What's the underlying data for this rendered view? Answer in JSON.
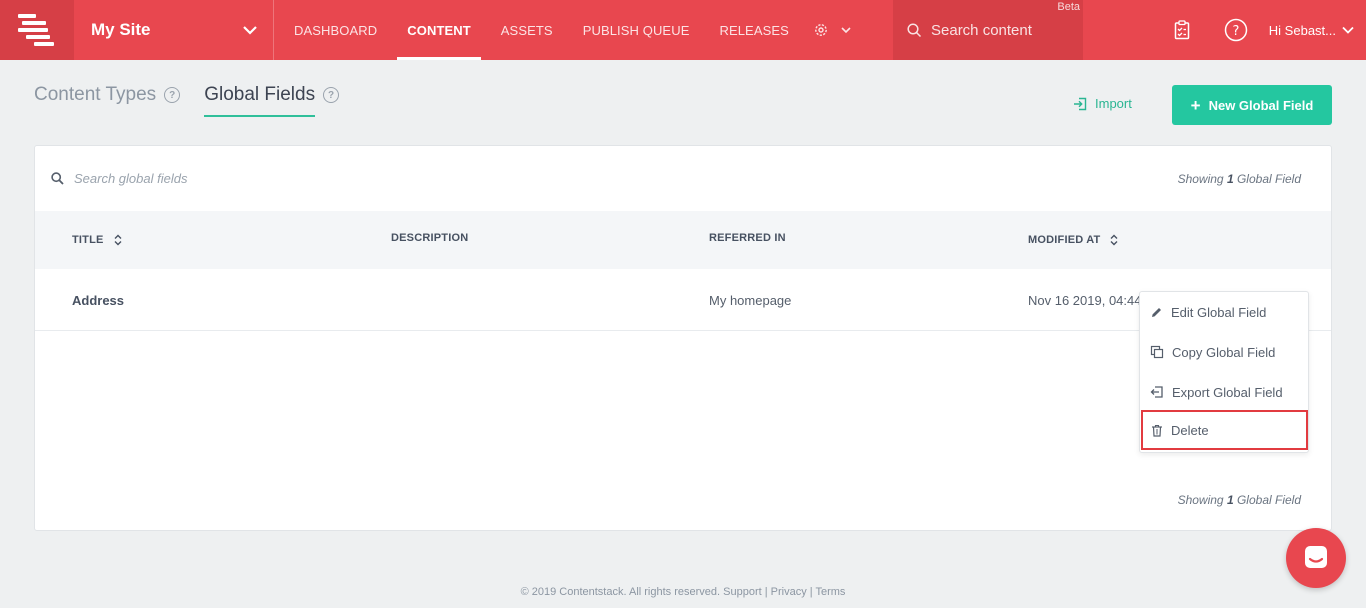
{
  "topbar": {
    "site_name": "My Site",
    "nav": [
      "DASHBOARD",
      "CONTENT",
      "ASSETS",
      "PUBLISH QUEUE",
      "RELEASES"
    ],
    "active_nav": "CONTENT",
    "search_placeholder": "Search content",
    "beta_label": "Beta",
    "user_label": "Hi  Sebast...",
    "accent": "#e8474f"
  },
  "tabs": {
    "content_types": "Content Types",
    "global_fields": "Global Fields"
  },
  "actions": {
    "import_label": "Import",
    "new_label": "New Global Field"
  },
  "panel": {
    "search_placeholder": "Search global fields",
    "showing_prefix": "Showing",
    "showing_count": "1",
    "showing_suffix": "Global Field",
    "columns": [
      "TITLE",
      "DESCRIPTION",
      "REFERRED IN",
      "MODIFIED AT"
    ],
    "rows": [
      {
        "title": "Address",
        "description": "",
        "referred_in": "My homepage",
        "modified_at": "Nov 16 2019, 04:44"
      }
    ]
  },
  "menu": {
    "items": [
      "Edit Global Field",
      "Copy Global Field",
      "Export Global Field",
      "Delete"
    ]
  },
  "footer": {
    "text": "© 2019 Contentstack. All rights reserved. Support | Privacy | Terms"
  }
}
